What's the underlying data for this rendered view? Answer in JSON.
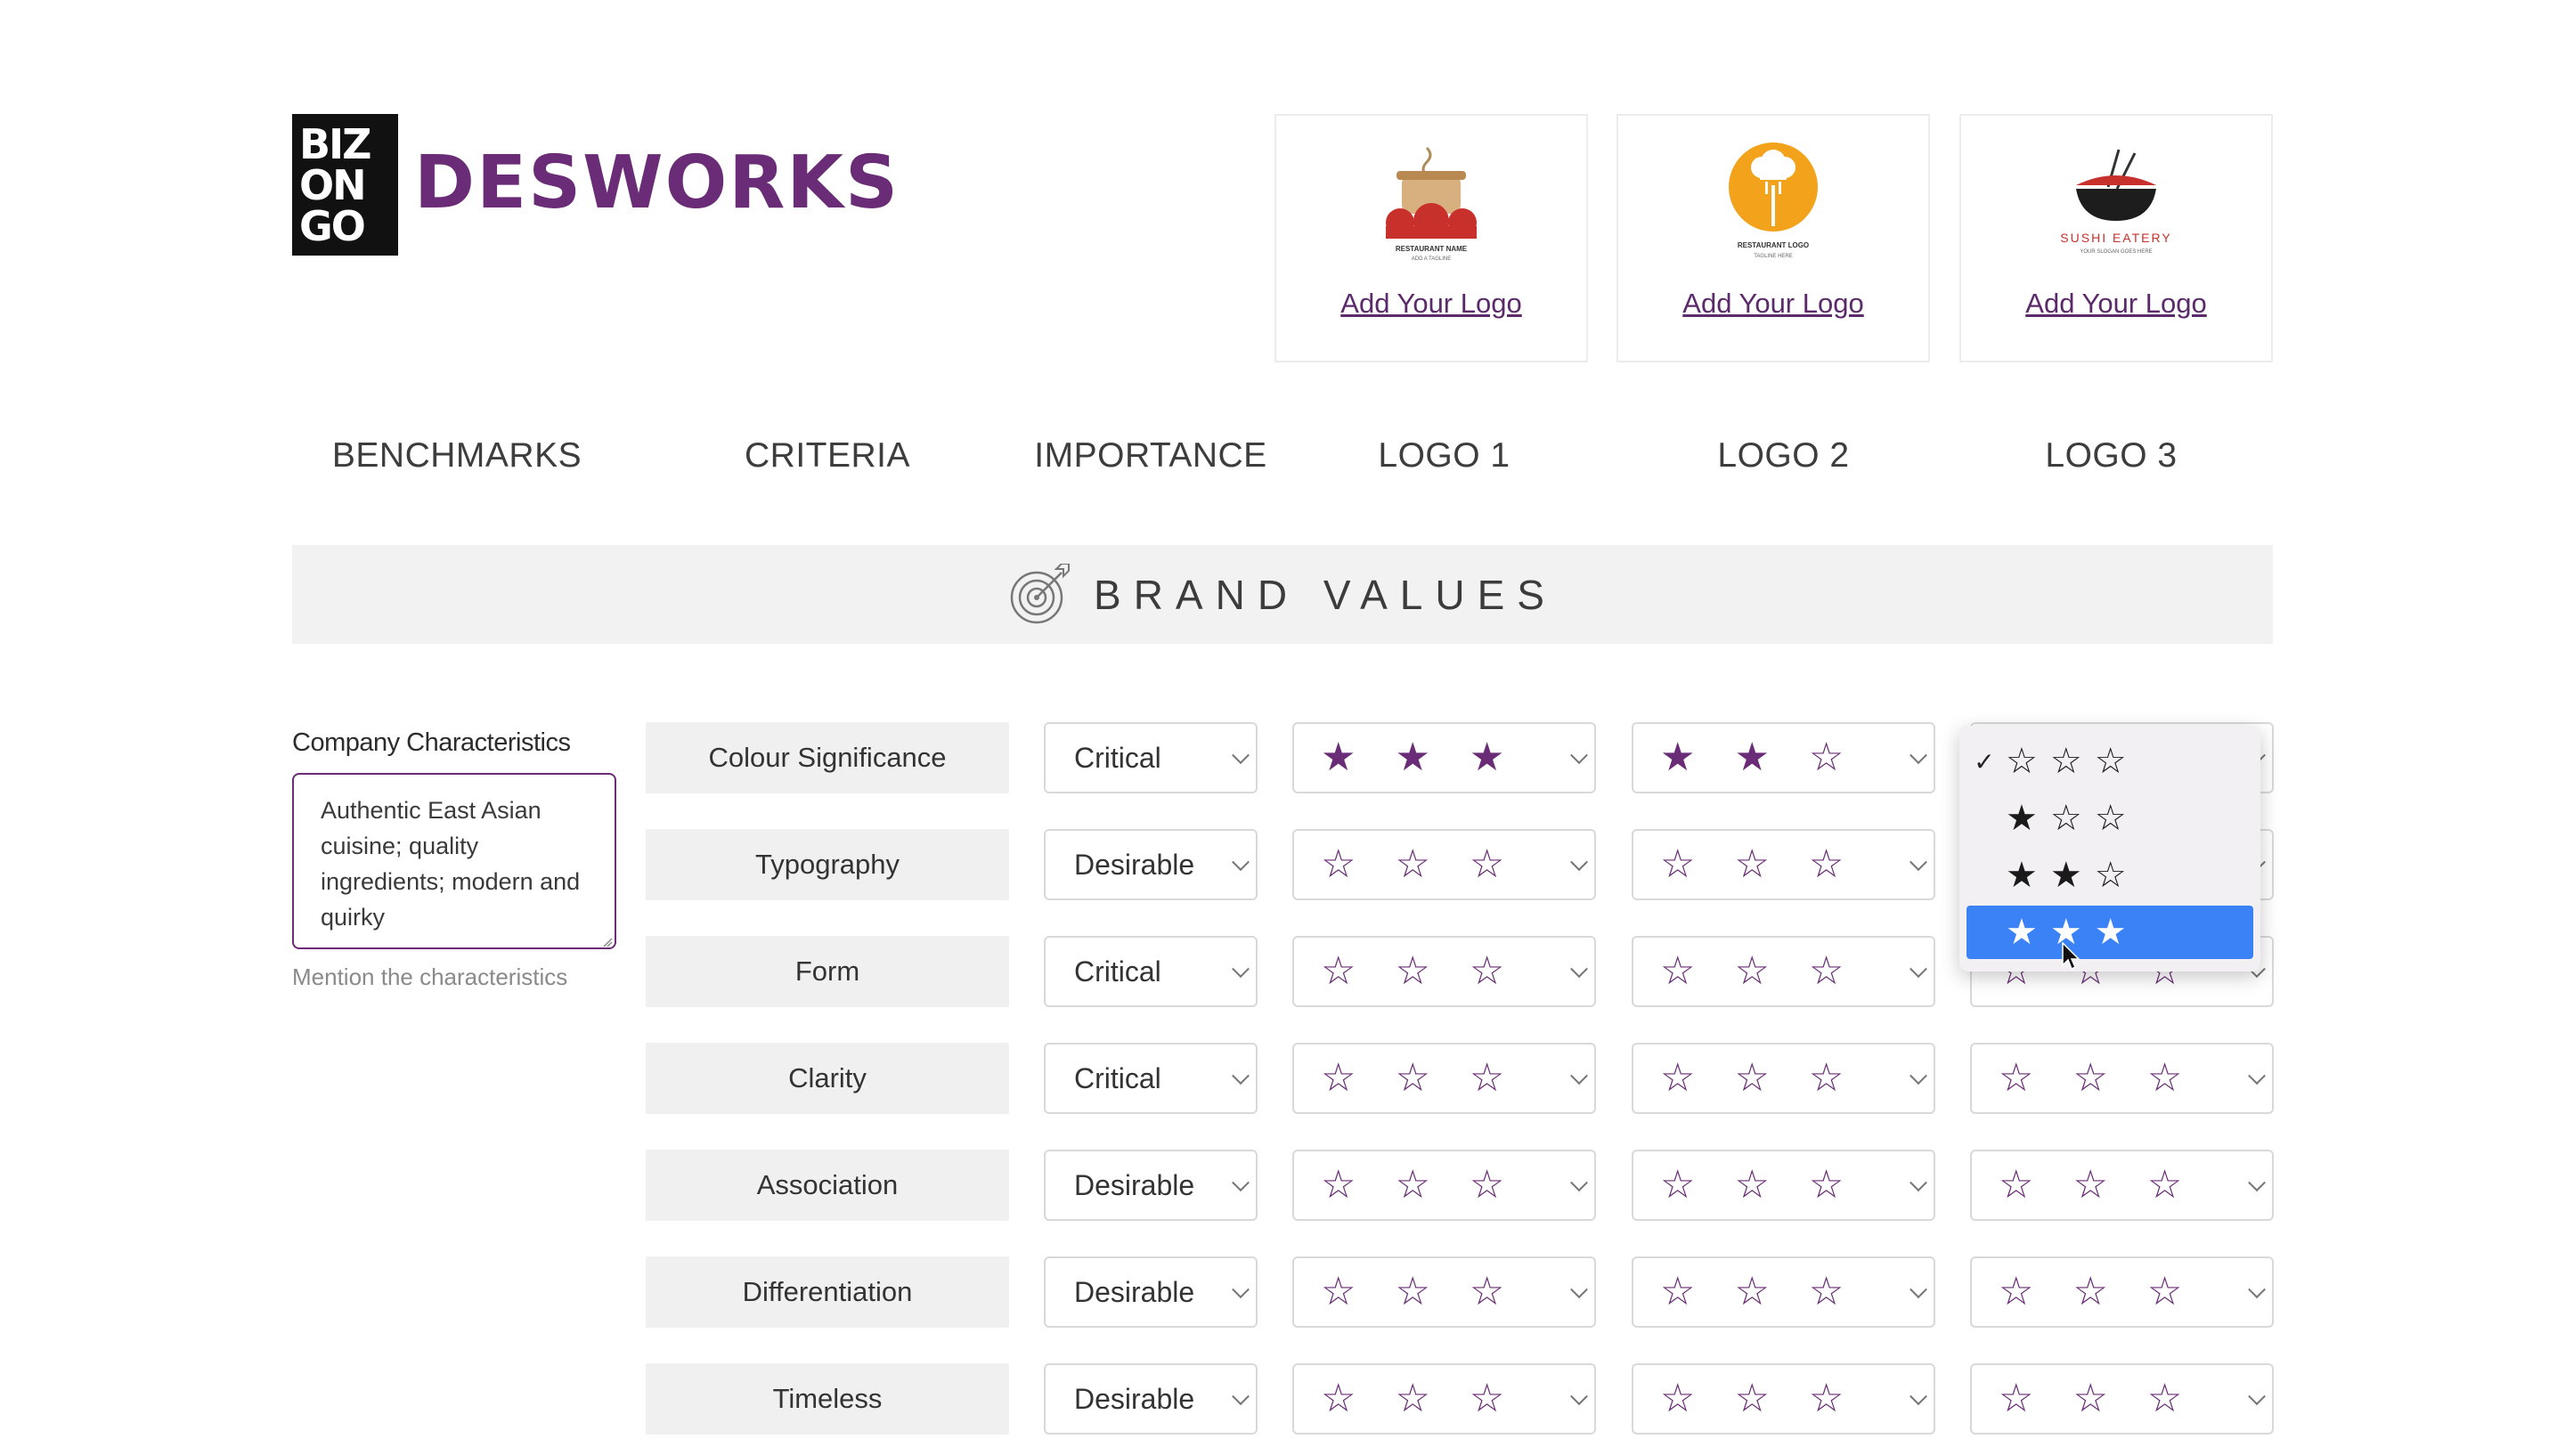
{
  "brand": {
    "mark_lines": [
      "BIZ",
      "ON",
      "GO"
    ],
    "name": "DESWORKS"
  },
  "logo_cards": [
    {
      "add_label": "Add Your Logo",
      "art_caption": "RESTAURANT NAME",
      "art_tagline": "ADD A TAGLINE"
    },
    {
      "add_label": "Add Your Logo",
      "art_caption": "RESTAURANT LOGO",
      "art_tagline": "TAGLINE HERE"
    },
    {
      "add_label": "Add Your Logo",
      "art_caption": "SUSHI EATERY",
      "art_tagline": "YOUR SLOGAN GOES HERE"
    }
  ],
  "columns": [
    "BENCHMARKS",
    "CRITERIA",
    "IMPORTANCE",
    "LOGO 1",
    "LOGO 2",
    "LOGO 3"
  ],
  "section": {
    "title": "BRAND VALUES",
    "icon": "target-icon"
  },
  "characteristics": {
    "label": "Company Characteristics",
    "value": "Authentic East Asian cuisine; quality ingredients; modern and quirky",
    "hint": "Mention the characteristics"
  },
  "rows": [
    {
      "criterion": "Colour Significance",
      "importance": "Critical",
      "logo1": 3,
      "logo2": 2,
      "logo3": 0
    },
    {
      "criterion": "Typography",
      "importance": "Desirable",
      "logo1": 0,
      "logo2": 0,
      "logo3": 0
    },
    {
      "criterion": "Form",
      "importance": "Critical",
      "logo1": 0,
      "logo2": 0,
      "logo3": 0
    },
    {
      "criterion": "Clarity",
      "importance": "Critical",
      "logo1": 0,
      "logo2": 0,
      "logo3": 0
    },
    {
      "criterion": "Association",
      "importance": "Desirable",
      "logo1": 0,
      "logo2": 0,
      "logo3": 0
    },
    {
      "criterion": "Differentiation",
      "importance": "Desirable",
      "logo1": 0,
      "logo2": 0,
      "logo3": 0
    },
    {
      "criterion": "Timeless",
      "importance": "Desirable",
      "logo1": 0,
      "logo2": 0,
      "logo3": 0
    }
  ],
  "dropdown": {
    "options": [
      {
        "rating": 0,
        "checked": true,
        "highlighted": false
      },
      {
        "rating": 1,
        "checked": false,
        "highlighted": false
      },
      {
        "rating": 2,
        "checked": false,
        "highlighted": false
      },
      {
        "rating": 3,
        "checked": false,
        "highlighted": true
      }
    ],
    "check_glyph": "✓"
  },
  "colors": {
    "accent": "#6a2c76",
    "highlight": "#3b82f6",
    "banner_bg": "#f2f2f2"
  },
  "glyphs": {
    "star_filled": "★",
    "star_empty": "☆"
  }
}
